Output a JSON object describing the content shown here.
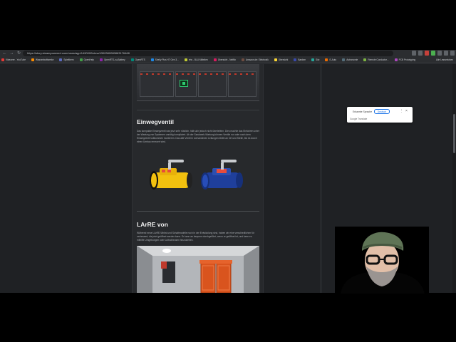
{
  "browser": {
    "url": "https://story.steampowered.com/news/app/1490000/view/4300380089863176468",
    "bookmarks": [
      {
        "label": "Videoeer - YouTube",
        "color": "#e53935"
      },
      {
        "label": "Wasserkraftwerke",
        "color": "#fb8c00"
      },
      {
        "label": "Spielthem",
        "color": "#5c6bc0"
      },
      {
        "label": "OpenHelp",
        "color": "#43a047"
      },
      {
        "label": "OpenRTS-zu-Battery",
        "color": "#8e24aa"
      },
      {
        "label": "OpenRTS",
        "color": "#00897b"
      },
      {
        "label": "Shelly Plus HT Gen 3...",
        "color": "#1e88e5"
      },
      {
        "label": "ehs - BLU Mitteilen",
        "color": "#c0ca33"
      },
      {
        "label": "Übersicht - Netflix",
        "color": "#d81b60"
      },
      {
        "label": "Amazon.de: Elektronik",
        "color": "#6d4c41"
      },
      {
        "label": "Übersicht",
        "color": "#fdd835"
      },
      {
        "label": "Banken",
        "color": "#3949ab"
      },
      {
        "label": "Sitz",
        "color": "#26a69a"
      },
      {
        "label": "E-Auto",
        "color": "#ef6c00"
      },
      {
        "label": "Astronomie",
        "color": "#546e7a"
      },
      {
        "label": "Remote Conductor...",
        "color": "#7cb342"
      },
      {
        "label": "PCB Prototyping",
        "color": "#ab47bc"
      }
    ],
    "bookmarks_right": "Alle Lesezeichen"
  },
  "article": {
    "heading1": "Einwegventil",
    "para1": "Das kompakte Einwegventil war jetzt sehr nützlich, hält sich jedoch nicht überlebten. Dies machte das Einfahren unter der Wartung von Systemen unnötig kompliziert. Ab der Sandwerk-Wartung können Ventile nur oder nach dem Einwegventil vollkommen montieren. Das alte Ventil in vorhandenen Leitungen bleibt an Ort und Stelle, bis es durch einen Umbau erneuert wird.",
    "heading2": "LArRE von",
    "para2": "Während neue LArRE-Wirkst und Schaltmodelle noch in der Entwicklung sind, haben wir eine verschiedlichen für verbessert, die jetzt geöffnet werden kann. Er kann an bequem durchgeführt, wenn er geöffnet ist, und kann es mithilfe Umgebungen oder Luftschleusen hinzuziehen."
  },
  "translate": {
    "lang_source": "Erkannte Sprache",
    "lang_target": "Deutsch",
    "footer": "Google Translate"
  },
  "colors": {
    "valve_yellow": "#f2c10f",
    "valve_blue": "#1f3f9c",
    "valve_red": "#e74c3c",
    "handle": "#c9ccd0",
    "room_orange": "#d9541e"
  }
}
